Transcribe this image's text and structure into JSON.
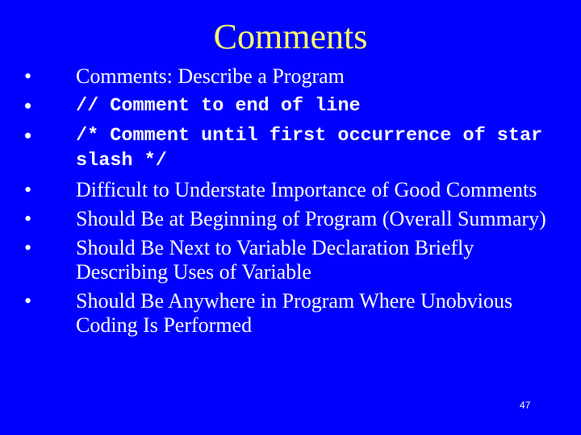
{
  "slide": {
    "title": "Comments",
    "bullet_glyph": "•",
    "bullets": [
      {
        "text": "Comments: Describe a Program",
        "style": "serif"
      },
      {
        "text": "// Comment to end of line",
        "style": "mono"
      },
      {
        "text": "/* Comment until first occurrence of star slash */",
        "style": "mono"
      },
      {
        "text": "Difficult to Understate Importance of Good Comments",
        "style": "serif"
      },
      {
        "text": "Should Be at Beginning of Program (Overall Summary)",
        "style": "serif"
      },
      {
        "text": "Should Be Next to Variable Declaration Briefly Describing Uses of Variable",
        "style": "serif"
      },
      {
        "text": "Should Be Anywhere in Program Where Unobvious Coding Is Performed",
        "style": "serif"
      }
    ],
    "page_number": "47",
    "colors": {
      "background": "#0000ff",
      "title": "#ffff66",
      "text": "#ffffff"
    }
  }
}
